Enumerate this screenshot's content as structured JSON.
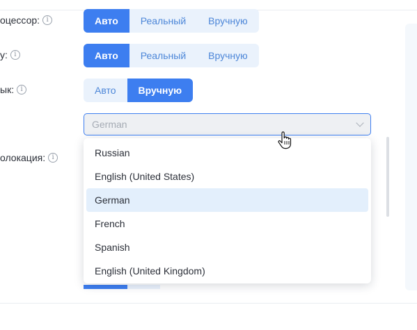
{
  "rows": [
    {
      "label": "оцессор:",
      "options": [
        "Авто",
        "Реальный",
        "Вручную"
      ],
      "selected": "Авто"
    },
    {
      "label": "у:",
      "options": [
        "Авто",
        "Реальный",
        "Вручную"
      ],
      "selected": "Авто"
    },
    {
      "label": "ык:",
      "options": [
        "Авто",
        "Вручную"
      ],
      "selected": "Вручную"
    }
  ],
  "language_select": {
    "value": "German",
    "options": [
      "Russian",
      "English (United States)",
      "German",
      "French",
      "Spanish",
      "English (United Kingdom)"
    ],
    "selected": "German"
  },
  "geolocation": {
    "label": "олокация:"
  },
  "colors": {
    "accent": "#3d7ef0",
    "segment_bg": "#eaf2fc",
    "selected_item_bg": "#e3effc"
  },
  "icons": {
    "info": "info-icon",
    "chevron": "chevron-down-icon",
    "cursor": "hand-pointer-icon"
  }
}
